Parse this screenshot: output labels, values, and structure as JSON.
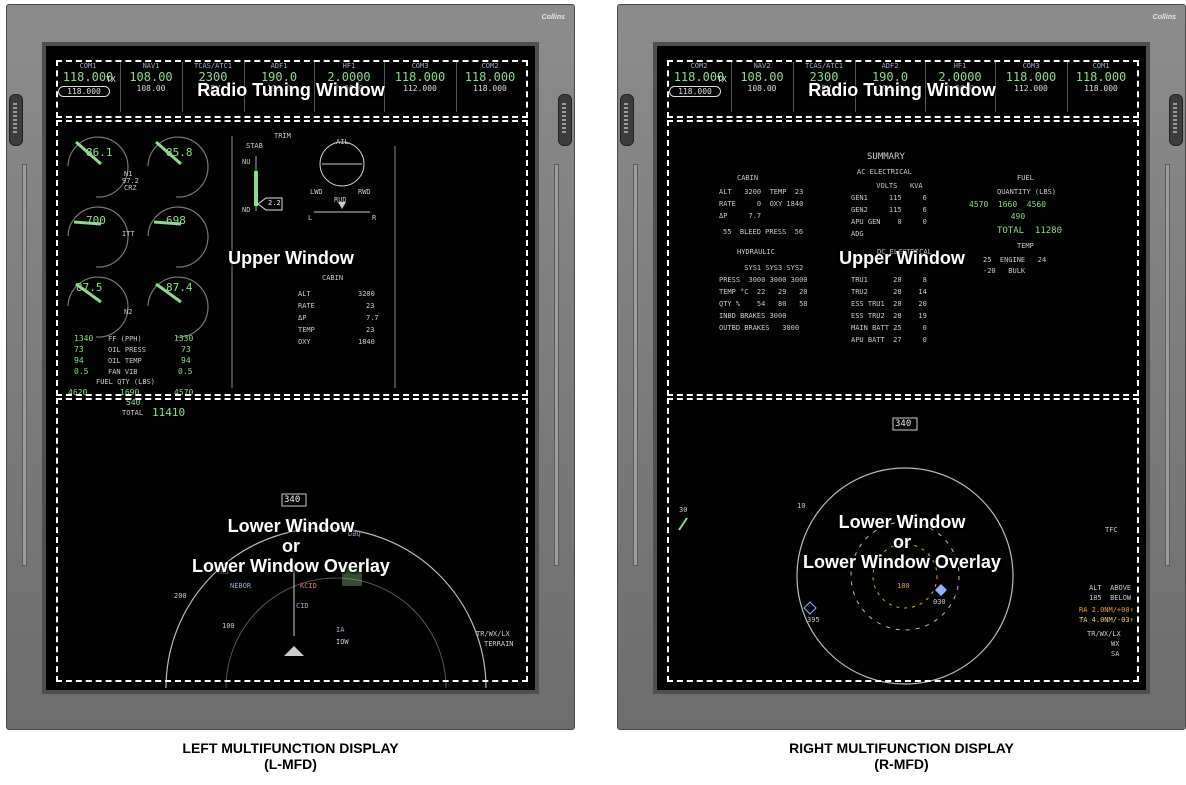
{
  "brand": "Collins",
  "zones": {
    "radio": "Radio Tuning Window",
    "upper": "Upper Window",
    "lower": "Lower Window\nor\nLower Window Overlay"
  },
  "left": {
    "caption_line1": "LEFT MULTIFUNCTION DISPLAY",
    "caption_line2": "(L-MFD)",
    "radio": [
      {
        "title": "COM1",
        "active": "118.000",
        "standby": "118.000",
        "mark": "TX"
      },
      {
        "title": "NAV1",
        "active": "108.00",
        "standby": "108.00"
      },
      {
        "title": "TCAS/ATC1",
        "active": "2300",
        "standby": "ABV"
      },
      {
        "title": "ADF1",
        "active": "190.0",
        "standby": "190.0"
      },
      {
        "title": "HF1",
        "active": "2.0000",
        "standby": "2.0000"
      },
      {
        "title": "COM3",
        "active": "118.000",
        "standby": "112.000"
      },
      {
        "title": "COM2",
        "active": "118.000",
        "standby": "118.000"
      }
    ],
    "engine": {
      "n1_left": "86.1",
      "n1_right": "85.8",
      "n1_label": "N1",
      "n1_sub": "97.2",
      "n1_mode": "CRZ",
      "itt_left": "700",
      "itt_right": "698",
      "itt_label": "ITT",
      "n2_left": "87.5",
      "n2_right": "87.4",
      "n2_label": "N2",
      "ff_label": "FF (PPH)",
      "ff_left": "1340",
      "ff_right": "1330",
      "oilp_label": "OIL PRESS",
      "oilp_left": "73",
      "oilp_right": "73",
      "oilt_label": "OIL TEMP",
      "oilt_left": "94",
      "oilt_right": "94",
      "fan_label": "FAN VIB",
      "fan_left": "0.5",
      "fan_right": "0.5",
      "fuel_label": "FUEL QTY (LBS)",
      "fuel_left": "4620",
      "fuel_center": "1690",
      "fuel_right": "4570",
      "fuel_ctr2": "540",
      "total_label": "TOTAL",
      "total": "11410"
    },
    "trim": {
      "title": "TRIM",
      "stab": "STAB",
      "nu": "NU",
      "nd": "ND",
      "stab_val": "2.2",
      "ail": "AIL",
      "lwd": "LWD",
      "rwd": "RWD",
      "rud": "RUD",
      "l": "L",
      "r": "R"
    },
    "cabin": {
      "title": "CABIN",
      "rows": [
        {
          "k": "ALT",
          "v": "3200"
        },
        {
          "k": "RATE",
          "v": "23"
        },
        {
          "k": "ΔP",
          "v": "7.7"
        },
        {
          "k": "TEMP",
          "v": "23"
        },
        {
          "k": "OXY",
          "v": "1840"
        }
      ]
    },
    "map": {
      "heading": "340",
      "ring1": "200",
      "ring2": "100",
      "wpts": [
        "DBQ",
        "NEBOR",
        "KCID",
        "CID",
        "IA",
        "IOW",
        "TRO"
      ],
      "tags": [
        "TR/WX/LX",
        "TERRAIN"
      ]
    }
  },
  "right": {
    "caption_line1": "RIGHT MULTIFUNCTION DISPLAY",
    "caption_line2": "(R-MFD)",
    "radio": [
      {
        "title": "COM2",
        "active": "118.000",
        "standby": "118.000",
        "mark": "TX"
      },
      {
        "title": "NAV2",
        "active": "108.00",
        "standby": "108.00"
      },
      {
        "title": "TCAS/ATC1",
        "active": "2300",
        "standby": "ABV"
      },
      {
        "title": "ADF2",
        "active": "190.0",
        "standby": "190.0"
      },
      {
        "title": "HF1",
        "active": "2.0000",
        "standby": "2.0000"
      },
      {
        "title": "COM3",
        "active": "118.000",
        "standby": "112.000"
      },
      {
        "title": "COM1",
        "active": "118.000",
        "standby": "118.000"
      }
    ],
    "summary": {
      "title": "SUMMARY",
      "cabin_title": "CABIN",
      "cabin_lines": [
        "ALT   3200  TEMP  23",
        "RATE     0  OXY 1840",
        "ΔP     7.7",
        "55  BLEED PRESS  56"
      ],
      "elec_title": "AC ELECTRICAL",
      "elec_head": "      VOLTS   KVA",
      "elec_lines": [
        "GEN1     115     6",
        "GEN2     115     6",
        "APU GEN    0     0",
        "ADG"
      ],
      "fuel_title": "FUEL",
      "fuel_lines": [
        "QUANTITY (LBS)",
        "4570  1660  4560",
        "       490",
        "TOTAL  11280",
        "TEMP",
        "25  ENGINE   24",
        "-20   BULK"
      ],
      "hyd_title": "HYDRAULIC",
      "hyd_lines": [
        "      SYS1 SYS3 SYS2",
        "PRESS  3000 3000 3000",
        "TEMP °C  22   29   20",
        "QTY %    54   80   58",
        "INBD BRAKES 3000",
        "OUTBD BRAKES   3000"
      ],
      "dc_title": "DC ELECTRICAL",
      "dc_lines": [
        "TRU1      28     8",
        "TRU2      28    14",
        "ESS TRU1  28    20",
        "ESS TRU2  28    19",
        "MAIN BATT 25     0",
        "APU BATT  27     0"
      ]
    },
    "tcas": {
      "heading": "340",
      "range_label": "10",
      "ring_inner": "180",
      "bearing": "030",
      "left_val": "395",
      "traffic_alt": "30",
      "tfc": "TFC",
      "alt_lines": [
        "ALT  ABOVE",
        "185  BELOW"
      ],
      "ra": "RA 2.0NM/+00↑",
      "ta": "TA 4.0NM/-03↑",
      "tags": [
        "TR/WX/LX",
        "WX",
        "SA"
      ]
    }
  }
}
